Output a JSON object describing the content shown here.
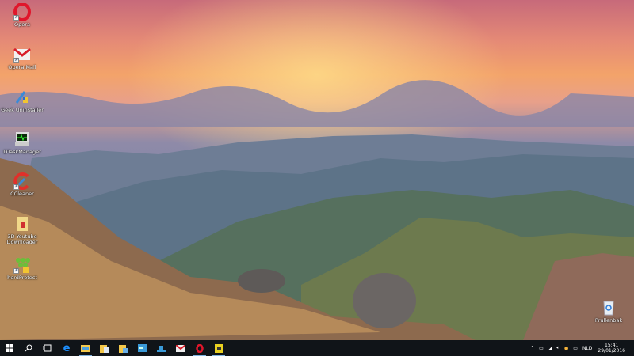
{
  "desktop": {
    "icons": [
      {
        "label": "Opera",
        "icon": "opera-icon"
      },
      {
        "label": "Opera Mail",
        "icon": "mail-icon"
      },
      {
        "label": "Geek Uninstaller",
        "icon": "geek-uninstaller-icon"
      },
      {
        "label": "DTaskManager",
        "icon": "task-manager-icon"
      },
      {
        "label": "CCleaner",
        "icon": "ccleaner-icon"
      },
      {
        "label": "3D Youtube Downloader",
        "icon": "downloader-icon"
      },
      {
        "label": "herdProtect",
        "icon": "herdprotect-icon"
      }
    ],
    "recycle_bin": {
      "label": "Prullenbak",
      "icon": "recycle-bin-icon"
    }
  },
  "taskbar": {
    "apps": [
      "start",
      "search",
      "task-view",
      "edge",
      "file-explorer",
      "documents",
      "pictures",
      "control-panel",
      "network",
      "opera-mail",
      "opera",
      "dtaskmanager"
    ],
    "tray": {
      "language": "NLD",
      "time": "15:41",
      "date": "29/01/2016"
    }
  },
  "colors": {
    "taskbar": "#101418",
    "accent": "#7fb2e0"
  }
}
